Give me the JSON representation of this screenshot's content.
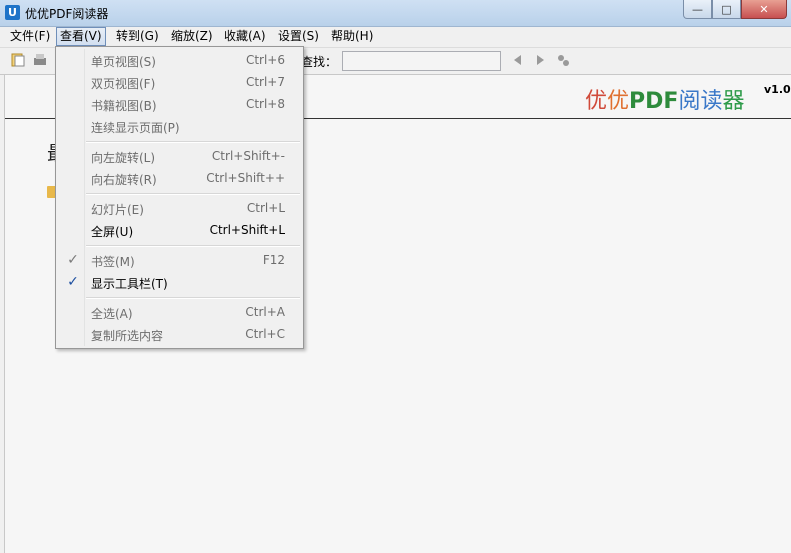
{
  "window": {
    "title": "优优PDF阅读器",
    "icon_letter": "U",
    "buttons": {
      "minimize": "—",
      "maximize": "□",
      "close": "✕"
    }
  },
  "menubar": [
    {
      "label": "文件(F)"
    },
    {
      "label": "查看(V)"
    },
    {
      "label": "转到(G)"
    },
    {
      "label": "缩放(Z)"
    },
    {
      "label": "收藏(A)"
    },
    {
      "label": "设置(S)"
    },
    {
      "label": "帮助(H)"
    }
  ],
  "toolbar": {
    "search_label": "查找："
  },
  "brand": {
    "part1": "优",
    "part2": "优",
    "part3": "PDF",
    "part4": "阅读",
    "part5": "器",
    "version": "v1.0"
  },
  "content": {
    "recent_title": "最"
  },
  "view_menu": {
    "items": [
      {
        "label": "单页视图(S)",
        "shortcut": "Ctrl+6"
      },
      {
        "label": "双页视图(F)",
        "shortcut": "Ctrl+7"
      },
      {
        "label": "书籍视图(B)",
        "shortcut": "Ctrl+8"
      },
      {
        "label": "连续显示页面(P)",
        "shortcut": ""
      },
      {
        "label": "向左旋转(L)",
        "shortcut": "Ctrl+Shift+-"
      },
      {
        "label": "向右旋转(R)",
        "shortcut": "Ctrl+Shift++"
      },
      {
        "label": "幻灯片(E)",
        "shortcut": "Ctrl+L"
      },
      {
        "label": "全屏(U)",
        "shortcut": "Ctrl+Shift+L"
      },
      {
        "label": "书签(M)",
        "shortcut": "F12"
      },
      {
        "label": "显示工具栏(T)",
        "shortcut": ""
      },
      {
        "label": "全选(A)",
        "shortcut": "Ctrl+A"
      },
      {
        "label": "复制所选内容",
        "shortcut": "Ctrl+C"
      }
    ],
    "check_glyph": "✓"
  },
  "colors": {
    "accent": "#1d4fa0",
    "menu_highlight_border": "#6f8fb9"
  }
}
